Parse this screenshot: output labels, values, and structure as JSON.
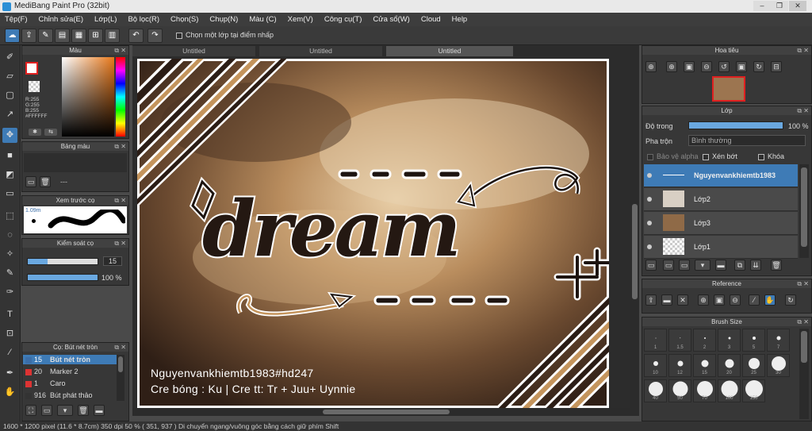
{
  "app": {
    "title": "MediBang Paint Pro (32bit)"
  },
  "menu": [
    "Tệp(F)",
    "Chỉnh sửa(E)",
    "Lớp(L)",
    "Bộ lọc(R)",
    "Chọn(S)",
    "Chụp(N)",
    "Màu (C)",
    "Xem(V)",
    "Công cụ(T)",
    "Cửa sổ(W)",
    "Cloud",
    "Help"
  ],
  "toolbar": {
    "select_one_layer": "Chọn một lớp tại điểm nhấp"
  },
  "color_panel": {
    "title": "Màu",
    "r": "R:255",
    "g": "G:255",
    "b": "B:255",
    "hex": "#FFFFFF"
  },
  "palette_panel": {
    "title": "Bảng màu",
    "empty": "---"
  },
  "brush_preview": {
    "title": "Xem trước cọ",
    "size": "1.09m"
  },
  "brush_control": {
    "title": "Kiểm soát cọ",
    "size": "15",
    "opacity": "100 %"
  },
  "brush_list": {
    "title": "Cọ: Bút nét tròn",
    "items": [
      {
        "size": "15",
        "name": "Bút nét tròn",
        "color": "#3b6ea8"
      },
      {
        "size": "20",
        "name": "Marker 2",
        "color": "#d33"
      },
      {
        "size": "1",
        "name": "Caro",
        "color": "#d33"
      },
      {
        "size": "916",
        "name": "Bút phát thảo",
        "color": "#333"
      }
    ]
  },
  "tabs": [
    "Untitled",
    "Untitled",
    "Untitled"
  ],
  "canvas": {
    "watermark": "Nguyenvankhiemtb1983#hd247",
    "credits": "Cre bóng : Ku | Cre tt: Tr + Juu+ Uynnie",
    "word": "dream"
  },
  "navigator": {
    "title": "Hoa tiêu"
  },
  "layers_panel": {
    "title": "Lớp",
    "opacity_label": "Độ trong",
    "opacity_value": "100 %",
    "blend_label": "Pha trộn",
    "blend_value": "Bình thường",
    "protect_alpha": "Bảo vệ alpha",
    "clipping": "Xén bớt",
    "lock": "Khóa",
    "layers": [
      {
        "name": "Nguyenvankhiemtb1983"
      },
      {
        "name": "Lớp2"
      },
      {
        "name": "Lớp3"
      },
      {
        "name": "Lớp1"
      }
    ]
  },
  "reference_panel": {
    "title": "Reference"
  },
  "brush_size_panel": {
    "title": "Brush Size",
    "sizes": [
      "1",
      "1.5",
      "2",
      "3",
      "5",
      "7",
      "10",
      "12",
      "15",
      "20",
      "25",
      "30",
      "40",
      "50",
      "70",
      "100",
      "150"
    ]
  },
  "status": {
    "text": "1600 * 1200 pixel  (11.6 * 8.7cm)  350 dpi  50 %  ( 351, 937 )  Di chuyển ngang/vuông góc bằng cách giữ phím Shift"
  }
}
